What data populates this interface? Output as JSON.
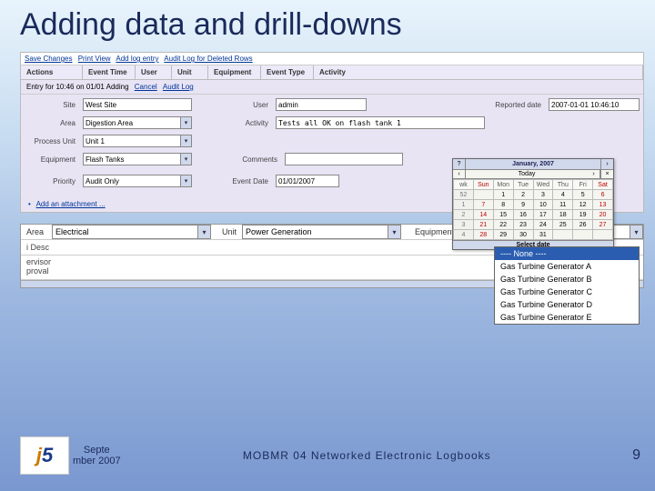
{
  "title": "Adding data and drill-downs",
  "topbar": {
    "save": "Save Changes",
    "print": "Print View",
    "addlog": "Add log entry",
    "audit": "Audit Log for Deleted Rows"
  },
  "headers": {
    "actions": "Actions",
    "eventtime": "Event Time",
    "user": "User",
    "unit": "Unit",
    "equipment": "Equipment",
    "eventtype": "Event Type",
    "activity": "Activity"
  },
  "entry": {
    "text": "Entry for 10:46 on 01/01 Adding",
    "cancel": "Cancel",
    "audit": "Audit Log"
  },
  "form": {
    "site_lbl": "Site",
    "site_val": "West Site",
    "user_lbl": "User",
    "user_val": "admin",
    "reported_lbl": "Reported date",
    "reported_val": "2007-01-01 10:46:10",
    "area_lbl": "Area",
    "area_val": "Digestion Area",
    "activity_lbl": "Activity",
    "activity_val": "Tests all OK on flash tank 1",
    "procunit_lbl": "Process Unit",
    "procunit_val": "Unit 1",
    "equip_lbl": "Equipment",
    "equip_val": "Flash Tanks",
    "comments_lbl": "Comments",
    "priority_lbl": "Priority",
    "priority_val": "Audit Only",
    "eventdate_lbl": "Event Date",
    "eventdate_val": "01/01/2007",
    "attach": "Add an attachment ..."
  },
  "cal": {
    "month": "January, 2007",
    "today": "Today",
    "dows": [
      "wk",
      "Sun",
      "Mon",
      "Tue",
      "Wed",
      "Thu",
      "Fri",
      "Sat"
    ],
    "rows": [
      [
        "52",
        "",
        "1",
        "2",
        "3",
        "4",
        "5",
        "6"
      ],
      [
        "1",
        "7",
        "8",
        "9",
        "10",
        "11",
        "12",
        "13"
      ],
      [
        "2",
        "14",
        "15",
        "16",
        "17",
        "18",
        "19",
        "20"
      ],
      [
        "3",
        "21",
        "22",
        "23",
        "24",
        "25",
        "26",
        "27"
      ],
      [
        "4",
        "28",
        "29",
        "30",
        "31",
        "",
        "",
        ""
      ]
    ],
    "foot": "Select date"
  },
  "panel2": {
    "area_lbl": "Area",
    "area_val": "Electrical",
    "unit_lbl": "Unit",
    "unit_val": "Power Generation",
    "equip_lbl": "Equipment",
    "equip_val": "Gas Turbine Generator A",
    "desc_lbl": "i Desc",
    "approval_lbl1": "ervisor",
    "approval_lbl2": "proval",
    "options": [
      "---- None ----",
      "Gas Turbine Generator A",
      "Gas Turbine Generator B",
      "Gas Turbine Generator C",
      "Gas Turbine Generator D",
      "Gas Turbine Generator E"
    ]
  },
  "footer": {
    "date1": "Septe",
    "date2": "mber 2007",
    "center": "MOBMR 04   Networked Electronic Logbooks",
    "page": "9"
  }
}
